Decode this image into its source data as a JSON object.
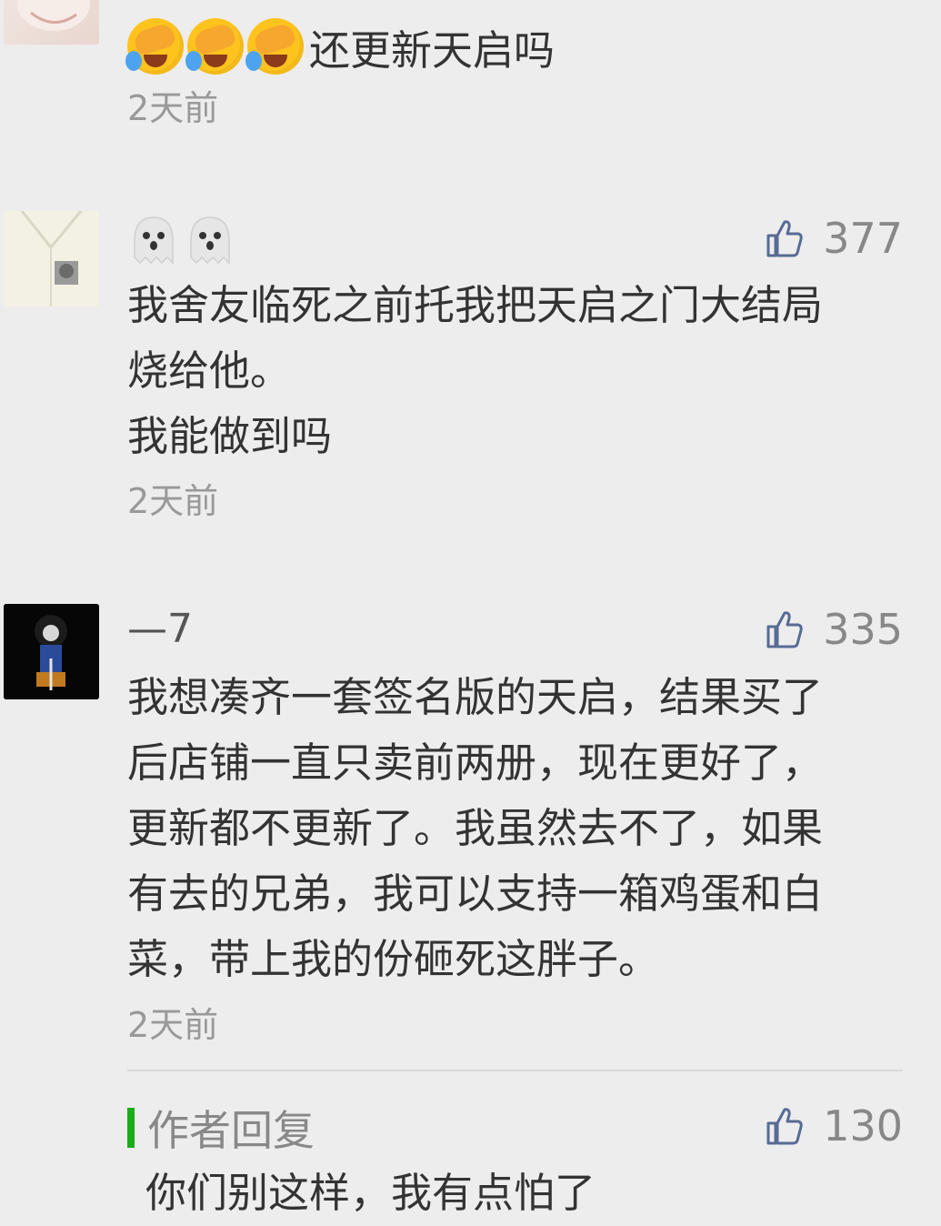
{
  "comments": [
    {
      "emoji_icons": [
        "face-palm-crying-emoji",
        "face-palm-crying-emoji",
        "face-palm-crying-emoji"
      ],
      "text": "还更新天启吗",
      "time": "2天前"
    },
    {
      "emoji_icons": [
        "ghost-emoji",
        "ghost-emoji"
      ],
      "likes": "377",
      "lines": [
        "我舍友临死之前托我把天启之门大结局",
        "烧给他。",
        "我能做到吗"
      ],
      "time": "2天前"
    },
    {
      "nickname": "—7",
      "likes": "335",
      "lines": [
        "我想凑齐一套签名版的天启，结果买了",
        "后店铺一直只卖前两册，现在更好了，",
        "更新都不更新了。我虽然去不了，如果",
        "有去的兄弟，我可以支持一箱鸡蛋和白",
        "菜，带上我的份砸死这胖子。"
      ],
      "time": "2天前",
      "reply": {
        "tag": "作者回复",
        "likes": "130",
        "text": "你们别这样，我有点怕了"
      }
    }
  ],
  "colors": {
    "accent_green": "#1aad19",
    "background": "#ededed"
  }
}
